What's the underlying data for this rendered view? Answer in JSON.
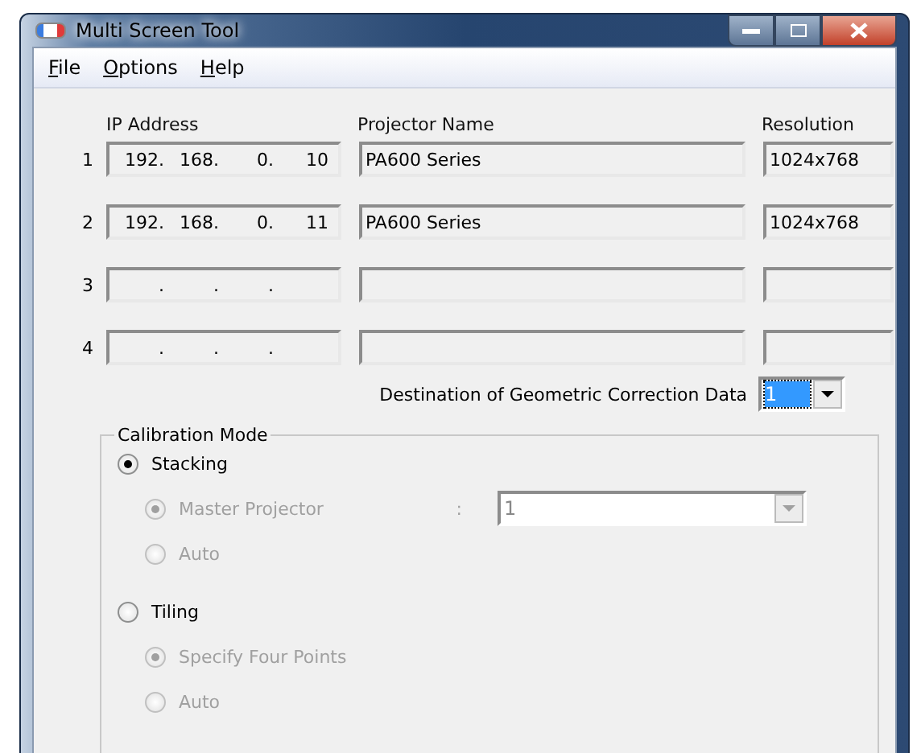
{
  "window": {
    "title": "Multi Screen Tool"
  },
  "menu": [
    {
      "label": "File"
    },
    {
      "label": "Options"
    },
    {
      "label": "Help"
    }
  ],
  "table": {
    "columns": [
      "IP Address",
      "Projector Name",
      "Resolution"
    ],
    "rows": [
      {
        "number": "1",
        "ip": [
          "192.",
          "168.",
          "0.",
          "10"
        ],
        "name": "PA600 Series",
        "resolution": "1024x768"
      },
      {
        "number": "2",
        "ip": [
          "192.",
          "168.",
          "0.",
          "11"
        ],
        "name": "PA600 Series",
        "resolution": "1024x768"
      },
      {
        "number": "3",
        "ip": [
          ".",
          ".",
          "."
        ]
      },
      {
        "number": "4",
        "ip": [
          ".",
          ".",
          "."
        ]
      }
    ]
  },
  "destination": {
    "label": "Destination of Geometric Correction Data",
    "value": "1",
    "focused": true
  },
  "calibration": {
    "title": "Calibration Mode",
    "options": [
      {
        "label": "Stacking",
        "selected": true,
        "disabled": false,
        "children": [
          {
            "label": "Master Projector",
            "selected": true,
            "disabled": true,
            "colon": ":",
            "combo": "1"
          },
          {
            "label": "Auto",
            "selected": false,
            "disabled": true
          }
        ]
      },
      {
        "label": "Tiling",
        "selected": false,
        "disabled": false,
        "children": [
          {
            "label": "Specify Four Points",
            "selected": true,
            "disabled": true
          },
          {
            "label": "Auto",
            "selected": false,
            "disabled": true
          }
        ]
      }
    ]
  }
}
